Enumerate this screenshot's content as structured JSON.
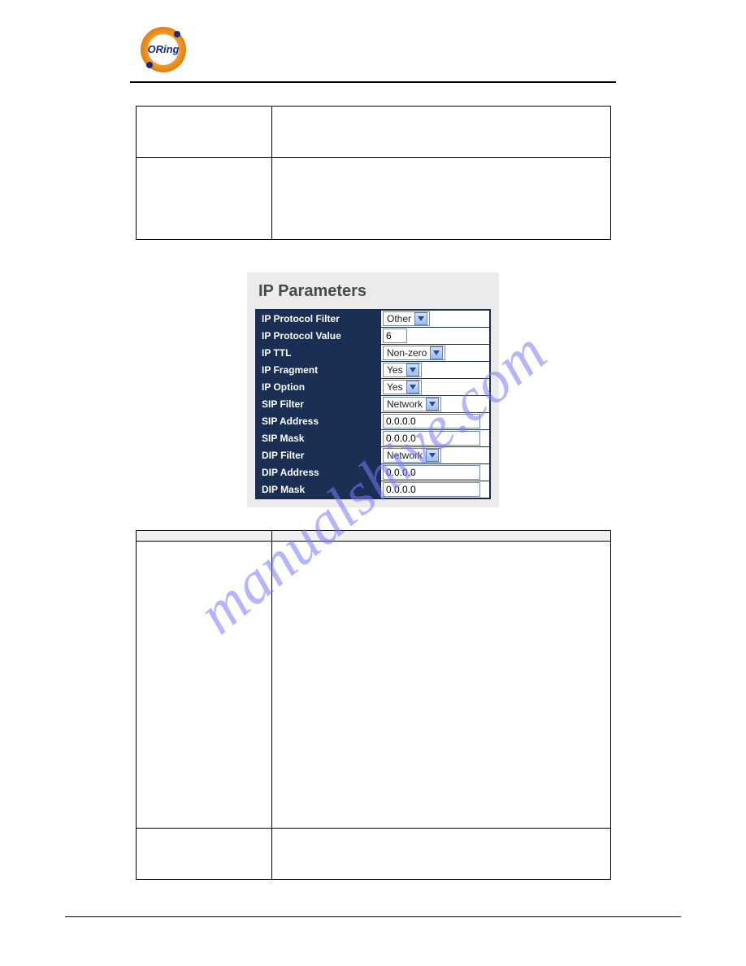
{
  "brand": {
    "name": "ORing"
  },
  "watermark": "manualshive.com",
  "upper_table": {
    "rows": [
      {
        "label": "",
        "desc": ""
      },
      {
        "label": "",
        "desc": ""
      }
    ]
  },
  "ip_parameters": {
    "title": "IP Parameters",
    "fields": {
      "ip_protocol_filter": {
        "label": "IP Protocol Filter",
        "value": "Other"
      },
      "ip_protocol_value": {
        "label": "IP Protocol Value",
        "value": "6"
      },
      "ip_ttl": {
        "label": "IP TTL",
        "value": "Non-zero"
      },
      "ip_fragment": {
        "label": "IP Fragment",
        "value": "Yes"
      },
      "ip_option": {
        "label": "IP Option",
        "value": "Yes"
      },
      "sip_filter": {
        "label": "SIP Filter",
        "value": "Network"
      },
      "sip_address": {
        "label": "SIP Address",
        "value": "0.0.0.0"
      },
      "sip_mask": {
        "label": "SIP Mask",
        "value": "0.0.0.0"
      },
      "dip_filter": {
        "label": "DIP Filter",
        "value": "Network"
      },
      "dip_address": {
        "label": "DIP Address",
        "value": "0.0.0.0"
      },
      "dip_mask": {
        "label": "DIP Mask",
        "value": "0.0.0.0"
      }
    }
  },
  "lower_table": {
    "header": {
      "c1": "",
      "c2": ""
    },
    "rows": [
      {
        "label": "",
        "desc": ""
      },
      {
        "label": "",
        "desc": ""
      }
    ]
  }
}
